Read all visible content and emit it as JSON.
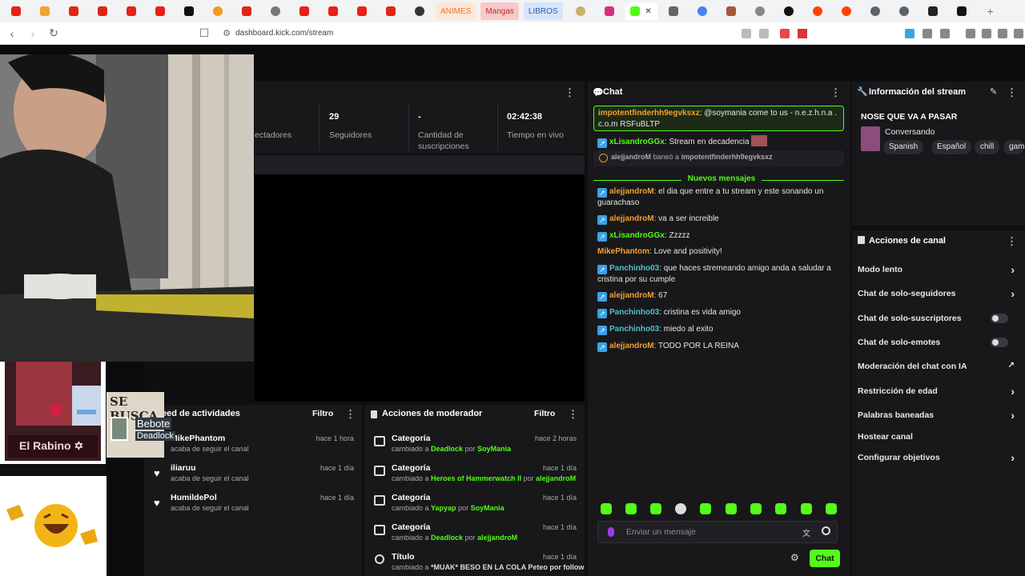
{
  "browser": {
    "tabs_text": [
      {
        "label": "ANIMES",
        "color": "#e07b39",
        "bg": "#fde7d6"
      },
      {
        "label": "Mangas",
        "color": "#c02b2b",
        "bg": "#f8c9c9"
      },
      {
        "label": "LIBROS",
        "color": "#1f5fbf",
        "bg": "#d7e4fa"
      }
    ],
    "url": "dashboard.kick.com/stream"
  },
  "stats": {
    "viewers_label": "ectadores",
    "followers_value": "29",
    "followers_label": "Seguidores",
    "subs_value": "-",
    "subs_label": "Cantidad de suscripciones",
    "time_value": "02:42:38",
    "time_label": "Tiempo en vivo"
  },
  "chat": {
    "title": "Chat",
    "pinned_user": "impotentfinderhh9egvksxz",
    "pinned_text": ": @soymania come to us - n.e.z.h.n.a . c.o.m RSFuBLTP",
    "msg_decadencia_user": "xLisandroGGx",
    "msg_decadencia_text": ": Stream en decadencia",
    "ban_user": "alejjandroM",
    "ban_action": "baneó a",
    "ban_target": "impotentfinderhh9egvksxz",
    "new_messages": "Nuevos mensajes",
    "messages": [
      {
        "user": "alejjandroM",
        "cls": "u-or",
        "text": ": el dia que entre a tu stream y este sonando un guarachaso"
      },
      {
        "user": "alejjandroM",
        "cls": "u-or",
        "text": ": va a ser increible"
      },
      {
        "user": "xLisandroGGx",
        "cls": "u-gr",
        "text": ": Zzzzz"
      },
      {
        "user": "MikePhantom",
        "cls": "u-or",
        "text": ": Love and positivity!"
      },
      {
        "user": "Panchinho03",
        "cls": "u-tl",
        "text": ": que haces stremeando amigo anda a saludar a cristina por su cumple"
      },
      {
        "user": "alejjandroM",
        "cls": "u-or",
        "text": ": 67"
      },
      {
        "user": "Panchinho03",
        "cls": "u-tl",
        "text": ": cristina es vida amigo"
      },
      {
        "user": "Panchinho03",
        "cls": "u-tl",
        "text": ": miedo al exito"
      },
      {
        "user": "alejjandroM",
        "cls": "u-or",
        "text": ": TODO POR LA REINA"
      }
    ],
    "input_placeholder": "Enviar un mensaje",
    "send_label": "Chat"
  },
  "stream_info": {
    "title": "Información del stream",
    "stream_title": "NOSE QUE VA A PASAR",
    "category": "Conversando",
    "tags": [
      "Spanish",
      "Español",
      "chill",
      "gam"
    ]
  },
  "channel_actions": {
    "title": "Acciones de canal",
    "items": [
      "Modo lento",
      "Chat de solo-seguidores",
      "Chat de solo-suscriptores",
      "Chat de solo-emotes",
      "Moderación del chat con IA",
      "Restricción de edad",
      "Palabras baneadas",
      "Hostear canal",
      "Configurar objetivos"
    ]
  },
  "activity_feed": {
    "title": "eed de actividades",
    "filter": "Filtro",
    "rows": [
      {
        "name": "MikePhantom",
        "sub": "acaba de seguir el canal",
        "time": "hace 1 hora"
      },
      {
        "name": "iliaruu",
        "sub": "acaba de seguir el canal",
        "time": "hace 1 día"
      },
      {
        "name": "HumildePol",
        "sub": "acaba de seguir el canal",
        "time": "hace 1 día"
      }
    ]
  },
  "mod_actions": {
    "title": "Acciones de moderador",
    "filter": "Filtro",
    "rows": [
      {
        "title": "Categoría",
        "pre": "cambiado a ",
        "value": "Deadlock",
        "mid": " por ",
        "by": "SoyMania",
        "time": "hace 2 horas"
      },
      {
        "title": "Categoría",
        "pre": "cambiado a ",
        "value": "Heroes of Hammerwatch II",
        "mid": " por ",
        "by": "alejjandroM",
        "time": "hace 1 día"
      },
      {
        "title": "Categoría",
        "pre": "cambiado a ",
        "value": "Yapyap",
        "mid": " por ",
        "by": "SoyMania",
        "time": "hace 1 día"
      },
      {
        "title": "Categoría",
        "pre": "cambiado a ",
        "value": "Deadlock",
        "mid": " por ",
        "by": "alejjandroM",
        "time": "hace 1 día"
      },
      {
        "title": "Título",
        "pre": "cambiado a ",
        "value": "*MUAK* BESO EN LA COLA Peteo por follow",
        "mid": "",
        "by": "",
        "time": "hace 1 día"
      }
    ]
  },
  "overlays": {
    "sticker_text": "El Rabino ✡",
    "wanted_title": "SE BUSCA",
    "wanted_name": "Bebote",
    "wanted_sub": "Deadlock"
  },
  "colors": {
    "accent": "#53fc18",
    "panel": "#18181b"
  }
}
